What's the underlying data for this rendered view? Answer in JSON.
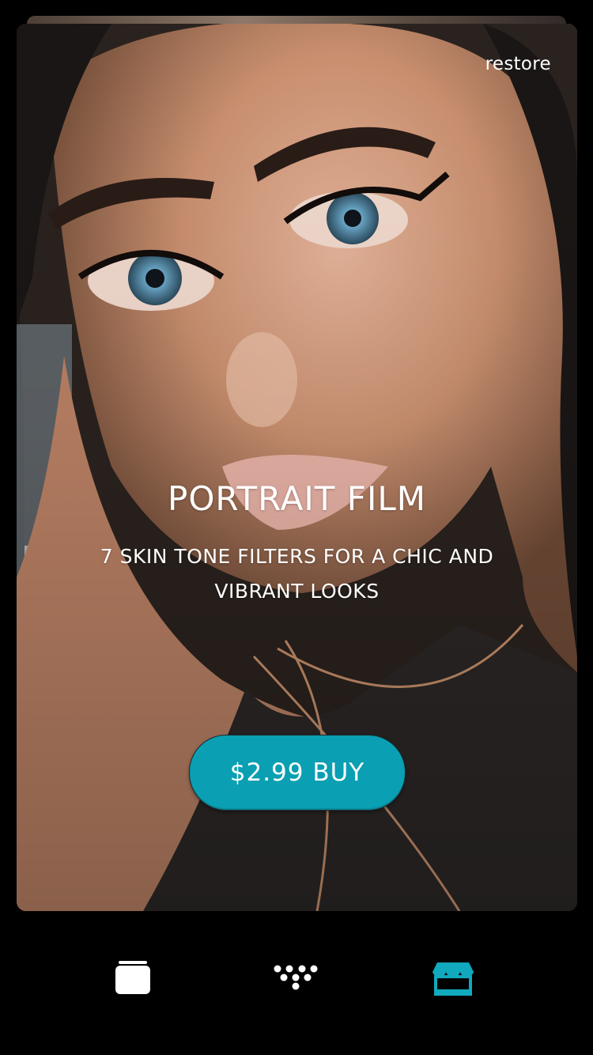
{
  "card": {
    "restore_label": "restore",
    "title": "PORTRAIT FILM",
    "subtitle": "7 SKIN TONE FILTERS FOR  A CHIC AND VIBRANT LOOKS",
    "buy_label": "$2.99 BUY"
  },
  "tabbar": {
    "items": [
      {
        "icon": "gallery-icon",
        "active": false
      },
      {
        "icon": "filters-dots-icon",
        "active": false
      },
      {
        "icon": "store-icon",
        "active": true
      }
    ]
  },
  "colors": {
    "accent": "#0a9fb2",
    "active_tab": "#10a9bd",
    "inactive_tab": "#ffffff",
    "background": "#000000"
  }
}
